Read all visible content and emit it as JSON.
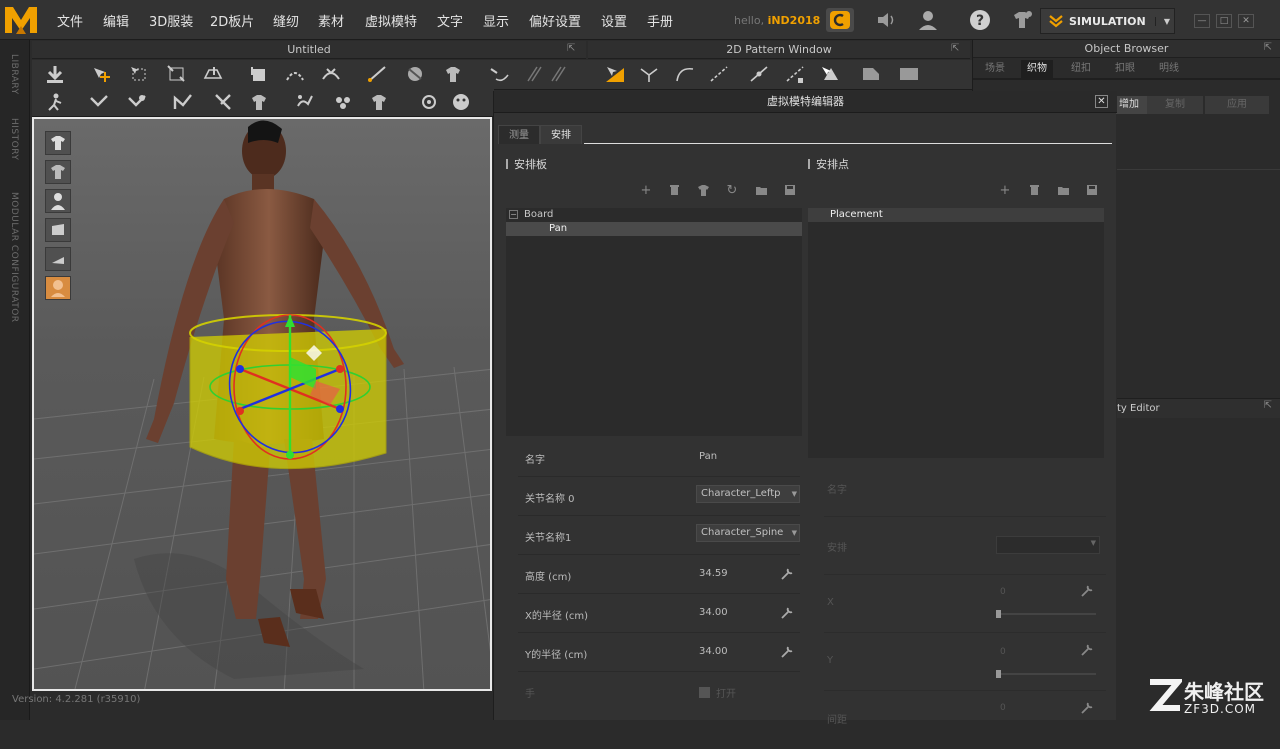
{
  "menubar": {
    "items": [
      "文件",
      "编辑",
      "3D服装",
      "2D板片",
      "缝纫",
      "素材",
      "虚拟模特",
      "文字",
      "显示",
      "偏好设置",
      "设置",
      "手册"
    ],
    "hello_prefix": "hello,",
    "username": "iND2018",
    "simulation_label": "SIMULATION"
  },
  "left_strip": {
    "tabs": [
      "LIBRARY",
      "HISTORY",
      "MODULAR CONFIGURATOR"
    ]
  },
  "panels": {
    "viewport_title": "Untitled",
    "pattern_title": "2D Pattern Window",
    "object_browser_title": "Object Browser",
    "property_editor_title": "ty Editor"
  },
  "object_browser": {
    "tabs": [
      "场景",
      "织物",
      "纽扣",
      "扣眼",
      "明线"
    ],
    "active_tab": "织物",
    "add_label": "增加",
    "copy_label": "复制",
    "apply_label": "应用"
  },
  "version": "Version: 4.2.281 (r35910)",
  "avatar_editor": {
    "title": "虚拟模特编辑器",
    "tabs": [
      "测量",
      "安排"
    ],
    "active_tab": "安排",
    "left_section": "安排板",
    "right_section": "安排点",
    "tree": {
      "root": "Board",
      "child": "Pan"
    },
    "placement_item": "Placement",
    "props": {
      "name_label": "名字",
      "name_value": "Pan",
      "joint0_label": "关节名称 0",
      "joint0_value": "Character_Leftp",
      "joint1_label": "关节名称1",
      "joint1_value": "Character_Spine",
      "height_label": "高度 (cm)",
      "height_value": "34.59",
      "xradius_label": "X的半径 (cm)",
      "xradius_value": "34.00",
      "yradius_label": "Y的半径 (cm)",
      "yradius_value": "34.00",
      "hand_label": "手",
      "hand_value": "打开"
    },
    "right_props": {
      "name_label": "名字",
      "arrange_label": "安排",
      "x_label": "X",
      "x_value": "0",
      "y_label": "Y",
      "y_value": "0",
      "z_label": "间距",
      "z_value": "0"
    }
  },
  "watermark": {
    "brand": "朱峰社区",
    "url": "ZF3D.COM"
  },
  "colors": {
    "accent": "#f0a000",
    "background": "#2b2b2b",
    "viewport_border": "#e8e8e8"
  }
}
